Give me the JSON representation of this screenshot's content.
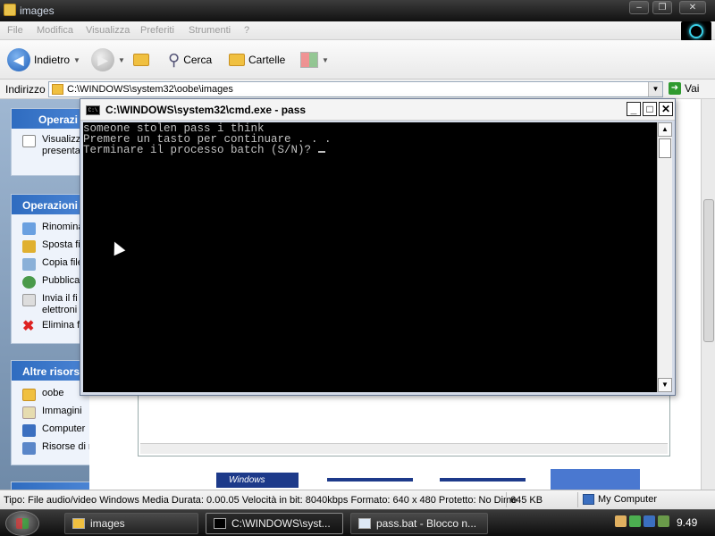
{
  "explorer": {
    "title": "images",
    "menu": [
      "File",
      "Modifica",
      "Visualizza",
      "Preferiti",
      "Strumenti",
      "?"
    ],
    "toolbar": {
      "back_label": "Indietro",
      "search_label": "Cerca",
      "folders_label": "Cartelle"
    },
    "address": {
      "label": "Indirizzo",
      "value": "C:\\WINDOWS\\system32\\oobe\\images",
      "go_label": "Vai"
    },
    "taskpane": {
      "panel1": {
        "header": "Operazi",
        "items": [
          "Visualizza",
          "presenta"
        ]
      },
      "panel2": {
        "header": "Operazioni",
        "items": [
          "Rinomina",
          "Sposta fi",
          "Copia file",
          "Pubblica",
          "Invia il fi",
          "elettroni",
          "Elimina fi"
        ]
      },
      "panel3": {
        "header": "Altre risors",
        "items": [
          "oobe",
          "Immagini",
          "Computer",
          "Risorse di rete"
        ]
      }
    },
    "status": {
      "text": "Tipo: File audio/video Windows Media Durata: 0.00.05 Velocità in bit: 8040kbps Formato: 640 x 480 Protetto: No Dime",
      "size": "645 KB",
      "zone": "My Computer"
    },
    "thumb_logo": "Windows"
  },
  "cmd": {
    "title": "C:\\WINDOWS\\system32\\cmd.exe - pass",
    "lines": [
      "someone stolen pass i think",
      "Premere un tasto per continuare . . .",
      "Terminare il processo batch (S/N)? "
    ]
  },
  "taskbar": {
    "buttons": [
      "images",
      "C:\\WINDOWS\\syst...",
      "pass.bat - Blocco n..."
    ],
    "clock": "9.49"
  },
  "colors": {
    "console_bg": "#000000",
    "console_fg": "#c0c0c0",
    "taskbar": "#1a1a1a",
    "panel_header": "#2f6cc0"
  }
}
